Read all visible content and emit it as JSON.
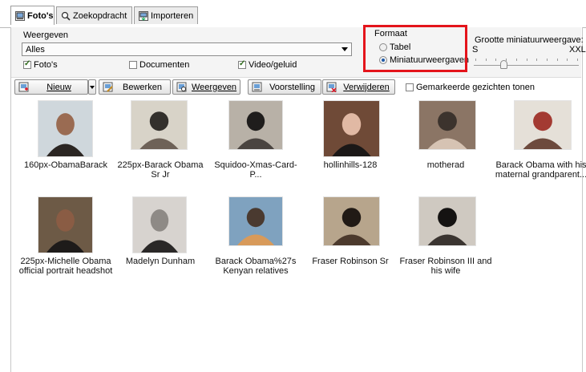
{
  "tabs": [
    {
      "label": "Foto's",
      "icon": "photo-tab-icon"
    },
    {
      "label": "Zoekopdracht",
      "icon": "search-icon"
    },
    {
      "label": "Importeren",
      "icon": "import-icon"
    }
  ],
  "view": {
    "label": "Weergeven",
    "selected": "Alles",
    "checkboxes": [
      {
        "label": "Foto's",
        "checked": true
      },
      {
        "label": "Documenten",
        "checked": false
      },
      {
        "label": "Video/geluid",
        "checked": true
      }
    ]
  },
  "format": {
    "label": "Formaat",
    "options": [
      {
        "label": "Tabel",
        "selected": false
      },
      {
        "label": "Miniatuurweergaven",
        "selected": true
      }
    ],
    "highlight_color": "#e4141b"
  },
  "thumb_size": {
    "label": "Grootte miniatuurweergave:",
    "min": "S",
    "max": "XXL",
    "level": 0.28
  },
  "toolbar": {
    "new": "Nieuw",
    "edit": "Bewerken",
    "show": "Weergeven",
    "slideshow": "Voorstelling",
    "delete": "Verwijderen",
    "marked_faces": "Gemarkeerde gezichten tonen"
  },
  "items": [
    {
      "caption": "160px-ObamaBarack"
    },
    {
      "caption": "225px-Barack Obama Sr Jr"
    },
    {
      "caption": "Squidoo-Xmas-Card-P..."
    },
    {
      "caption": "hollinhills-128"
    },
    {
      "caption": "motherad"
    },
    {
      "caption": "Barack Obama with his maternal grandparent..."
    },
    {
      "caption": "225px-Michelle Obama official portrait headshot"
    },
    {
      "caption": "Madelyn Dunham"
    },
    {
      "caption": "Barack Obama%27s Kenyan relatives"
    },
    {
      "caption": "Fraser Robinson Sr"
    },
    {
      "caption": "Fraser Robinson III and his wife"
    }
  ]
}
